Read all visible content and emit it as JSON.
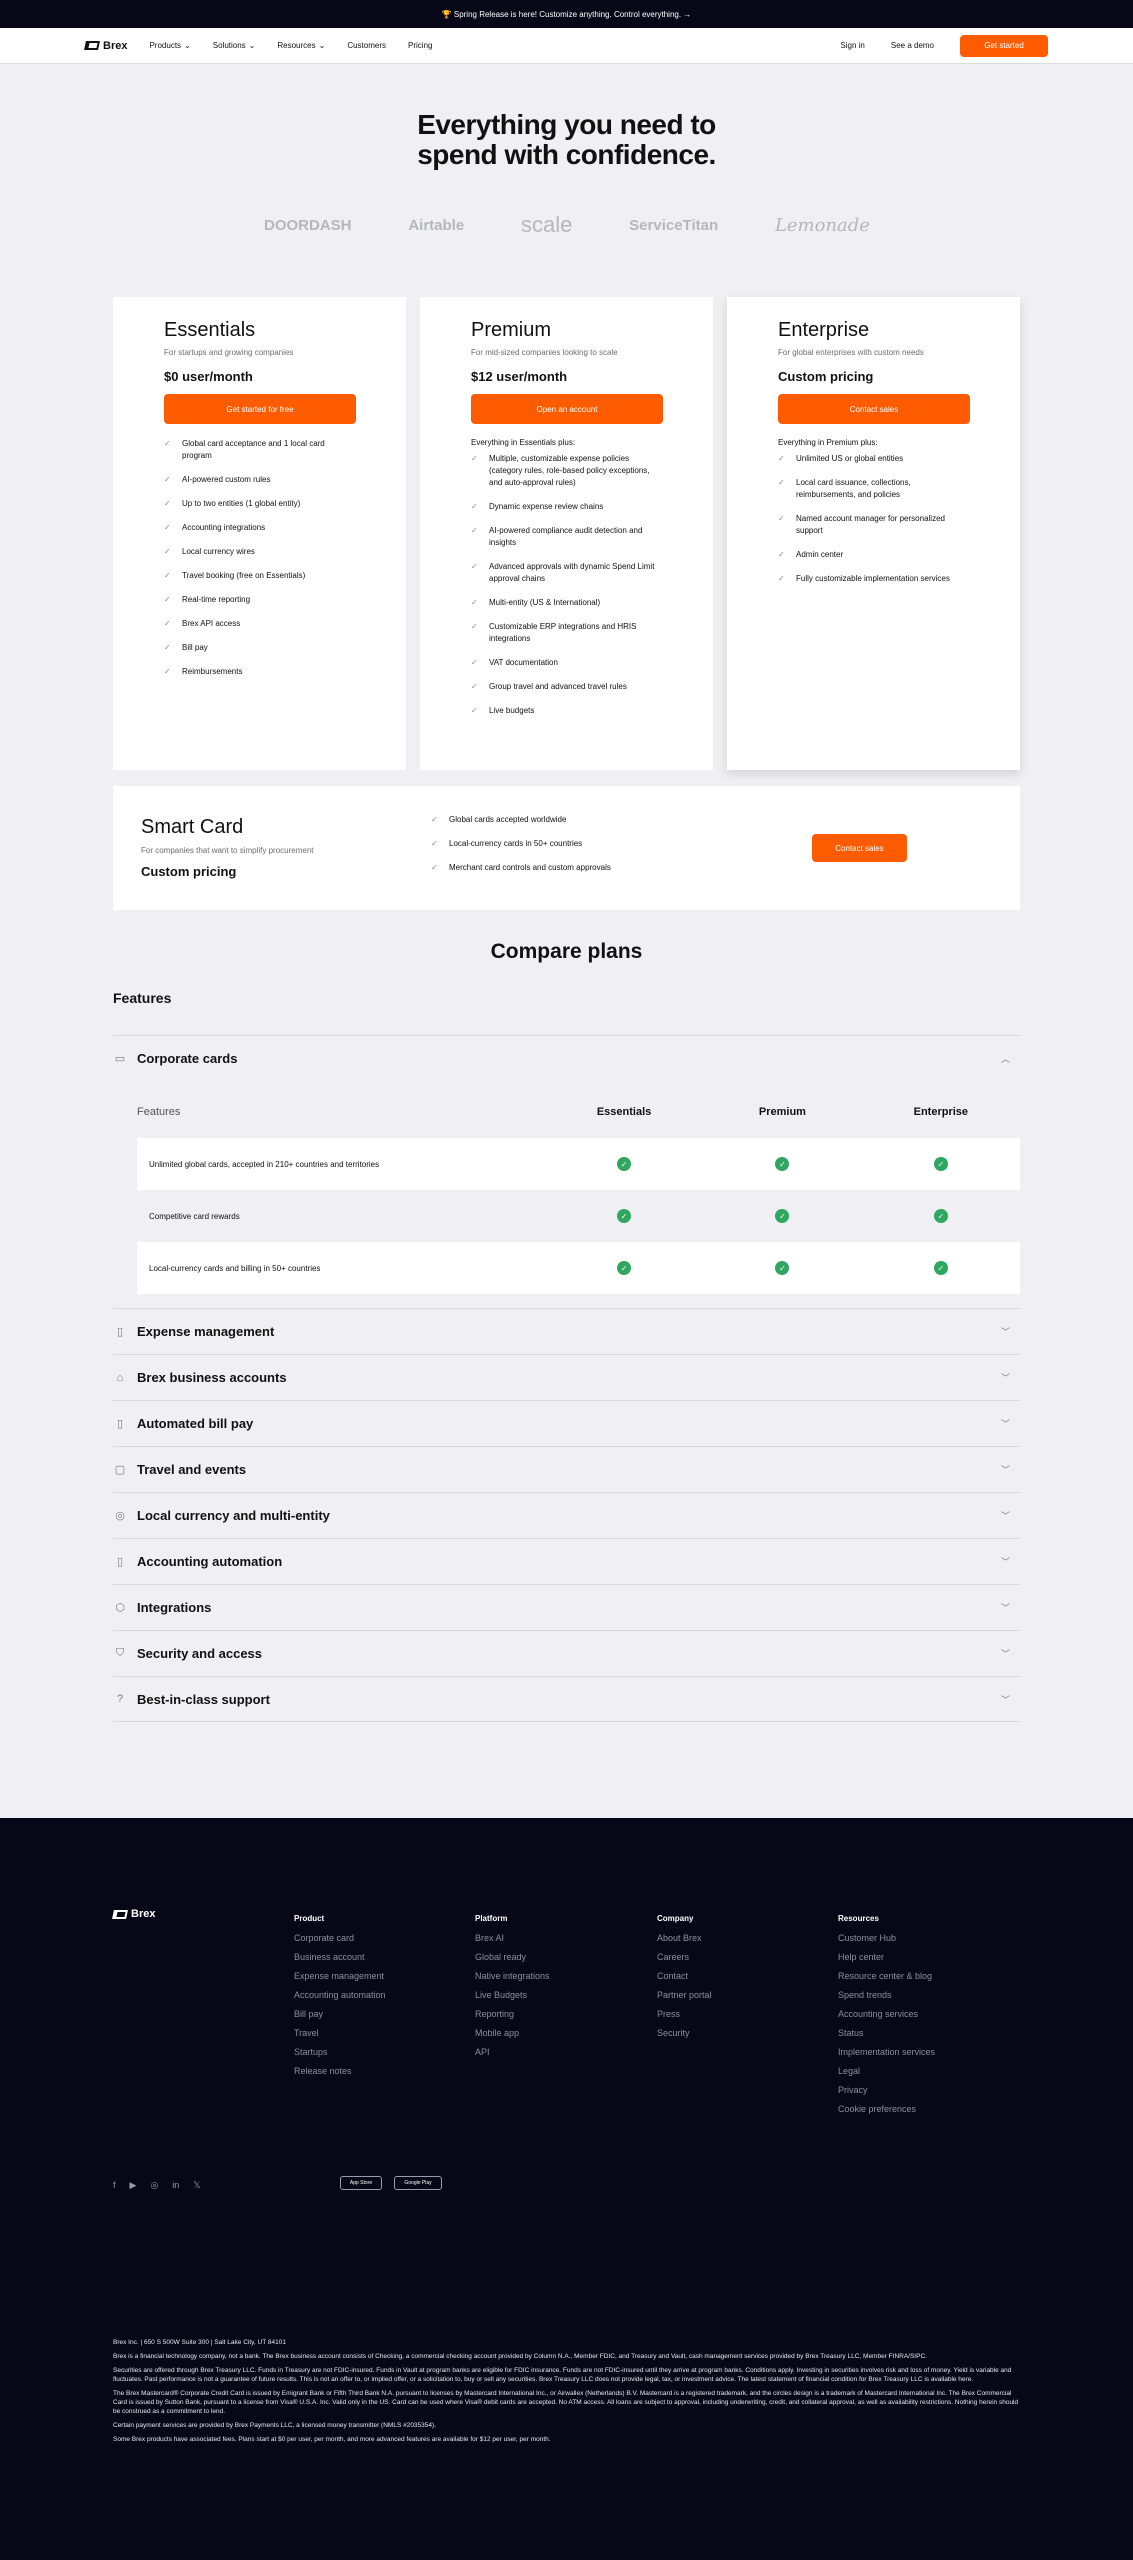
{
  "banner": "🏆 Spring Release is here! Customize anything. Control everything. →",
  "nav": {
    "logo": "Brex",
    "links": [
      "Products",
      "Solutions",
      "Resources",
      "Customers",
      "Pricing"
    ],
    "sign_in": "Sign in",
    "demo": "See a demo",
    "cta": "Get started"
  },
  "hero": {
    "line1": "Everything you need to",
    "line2": "spend with confidence."
  },
  "logos": [
    "DOORDASH",
    "Airtable",
    "scale",
    "ServiceTitan",
    "Lemonade"
  ],
  "plans": [
    {
      "name": "Essentials",
      "subtitle": "For startups and growing companies",
      "price": "$0 user/month",
      "cta": "Get started for free",
      "features": [
        "Global card acceptance and 1 local card program",
        "AI-powered custom rules",
        "Up to two entities (1 global entity)",
        "Accounting integrations",
        "Local currency wires",
        "Travel booking (free on Essentials)",
        "Real-time reporting",
        "Brex API access",
        "Bill pay",
        "Reimbursements"
      ]
    },
    {
      "name": "Premium",
      "subtitle": "For mid-sized companies looking to scale",
      "price": "$12 user/month",
      "cta": "Open an account",
      "plus": "Everything in Essentials plus:",
      "features": [
        "Multiple, customizable expense policies (category rules, role-based policy exceptions, and auto-approval rules)",
        "Dynamic expense review chains",
        "AI-powered compliance audit detection and insights",
        "Advanced approvals with dynamic Spend Limit approval chains",
        "Multi-entity (US & International)",
        "Customizable ERP integrations and HRIS integrations",
        "VAT documentation",
        "Group travel and advanced travel rules",
        "Live budgets"
      ]
    },
    {
      "name": "Enterprise",
      "subtitle": "For global enterprises with custom needs",
      "price": "Custom pricing",
      "cta": "Contact sales",
      "plus": "Everything in Premium plus:",
      "features": [
        "Unlimited US or global entities",
        "Local card issuance, collections, reimbursements, and policies",
        "Named account manager for personalized support",
        "Admin center",
        "Fully customizable implementation services"
      ]
    }
  ],
  "smart_card": {
    "name": "Smart Card",
    "subtitle": "For companies that want to simplify procurement",
    "price": "Custom pricing",
    "features": [
      "Global cards accepted worldwide",
      "Local-currency cards in 50+ countries",
      "Merchant card controls and custom approvals"
    ],
    "cta": "Contact sales"
  },
  "compare": {
    "title": "Compare plans",
    "features_label": "Features",
    "open_section": "Corporate cards",
    "table_header": [
      "Features",
      "Essentials",
      "Premium",
      "Enterprise"
    ],
    "rows": [
      "Unlimited global cards, accepted in 210+ countries and territories",
      "Competitive card rewards",
      "Local-currency cards and billing in 50+ countries"
    ],
    "sections": [
      "Expense management",
      "Brex business accounts",
      "Automated bill pay",
      "Travel and events",
      "Local currency and multi-entity",
      "Accounting automation",
      "Integrations",
      "Security and access",
      "Best-in-class support"
    ]
  },
  "footer": {
    "logo": "Brex",
    "columns": [
      {
        "title": "Product",
        "links": [
          "Corporate card",
          "Business account",
          "Expense management",
          "Accounting automation",
          "Bill pay",
          "Travel",
          "Startups",
          "Release notes"
        ]
      },
      {
        "title": "Platform",
        "links": [
          "Brex AI",
          "Global ready",
          "Native integrations",
          "Live Budgets",
          "Reporting",
          "Mobile app",
          "API"
        ]
      },
      {
        "title": "Company",
        "links": [
          "About Brex",
          "Careers",
          "Contact",
          "Partner portal",
          "Press",
          "Security"
        ]
      },
      {
        "title": "Resources",
        "links": [
          "Customer Hub",
          "Help center",
          "Resource center & blog",
          "Spend trends",
          "Accounting services",
          "Status",
          "Implementation services",
          "Legal",
          "Privacy",
          "Cookie preferences"
        ]
      }
    ],
    "socials": [
      "f",
      "▶",
      "◎",
      "in",
      "𝕏"
    ],
    "stores": [
      "App Store",
      "Google Play"
    ],
    "legal": [
      "Brex Inc. | 650 S 500W Suite 300 | Salt Lake City, UT 84101",
      "Brex is a financial technology company, not a bank. The Brex business account consists of Checking, a commercial checking account provided by Column N.A., Member FDIC, and Treasury and Vault, cash management services provided by Brex Treasury LLC, Member FINRA/SIPC.",
      "Securities are offered through Brex Treasury LLC. Funds in Treasury are not FDIC-insured. Funds in Vault at program banks are eligible for FDIC insurance. Funds are not FDIC-insured until they arrive at program banks. Conditions apply. Investing in securities involves risk and loss of money. Yield is variable and fluctuates. Past performance is not a guarantee of future results. This is not an offer to, or implied offer, or a solicitation to, buy or sell any securities. Brex Treasury LLC does not provide legal, tax, or investment advice. The latest statement of financial condition for Brex Treasury LLC is available here.",
      "The Brex Mastercard® Corporate Credit Card is issued by Emigrant Bank or Fifth Third Bank N.A. pursuant to licenses by Mastercard International Inc., or Airwallex (Netherlands) B.V. Mastercard is a registered trademark, and the circles design is a trademark of Mastercard International Inc. The Brex Commercial Card is issued by Sutton Bank, pursuant to a license from Visa® U.S.A. Inc. Valid only in the US. Card can be used where Visa® debit cards are accepted. No ATM access. All loans are subject to approval, including underwriting, credit, and collateral approval, as well as availability restrictions. Nothing herein should be construed as a commitment to lend.",
      "Certain payment services are provided by Brex Payments LLC, a licensed money transmitter (NMLS #2035354).",
      "Some Brex products have associated fees. Plans start at $0 per user, per month, and more advanced features are available for $12 per user, per month."
    ]
  }
}
